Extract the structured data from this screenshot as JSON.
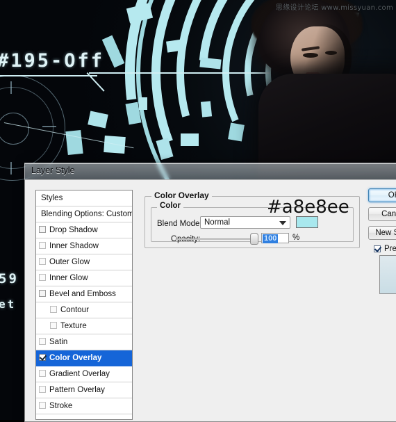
{
  "scene": {
    "watermark": "思缘设计论坛 www.missyuan.com",
    "led_main": "#195-Off",
    "led_side1": "59",
    "led_side2": "et",
    "accent_cyan": "#b6e9ef",
    "background_color": "#05070b"
  },
  "dialog": {
    "title": "Layer Style",
    "styles_list": [
      {
        "label": "Styles",
        "type": "plain"
      },
      {
        "label": "Blending Options: Custom",
        "type": "plain"
      },
      {
        "label": "Drop Shadow",
        "type": "effect",
        "checked": false
      },
      {
        "label": "Inner Shadow",
        "type": "effect",
        "checked": false
      },
      {
        "label": "Outer Glow",
        "type": "effect",
        "checked": false
      },
      {
        "label": "Inner Glow",
        "type": "effect",
        "checked": false
      },
      {
        "label": "Bevel and Emboss",
        "type": "effect",
        "checked": false
      },
      {
        "label": "Contour",
        "type": "sub",
        "checked": false
      },
      {
        "label": "Texture",
        "type": "sub",
        "checked": false
      },
      {
        "label": "Satin",
        "type": "effect",
        "checked": false
      },
      {
        "label": "Color Overlay",
        "type": "effect",
        "checked": true,
        "selected": true
      },
      {
        "label": "Gradient Overlay",
        "type": "effect",
        "checked": false
      },
      {
        "label": "Pattern Overlay",
        "type": "effect",
        "checked": false
      },
      {
        "label": "Stroke",
        "type": "effect",
        "checked": false
      }
    ],
    "panel": {
      "group_title": "Color Overlay",
      "subgroup_title": "Color",
      "blend_mode_label": "Blend Mode:",
      "blend_mode_value": "Normal",
      "color_swatch": "#a8e8ee",
      "opacity_label": "Opacity:",
      "opacity_value": "100",
      "opacity_unit": "%"
    },
    "buttons": {
      "ok": "OK",
      "cancel": "Cancel",
      "new_style": "New Style...",
      "preview": "Preview"
    },
    "annotation": "#a8e8ee"
  }
}
